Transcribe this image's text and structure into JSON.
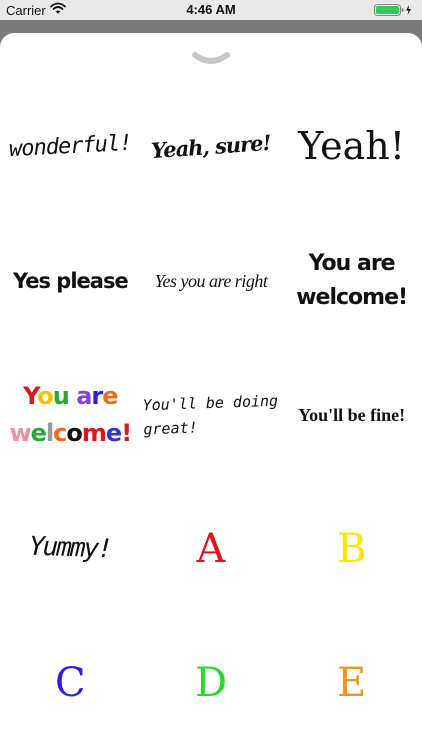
{
  "status_bar": {
    "carrier": "Carrier",
    "time": "4:46 AM"
  },
  "sheet": {
    "handle_icon": "chevron-down-icon"
  },
  "stickers": {
    "wonderful": "wonderful!",
    "yeah_sure": "Yeah, sure!",
    "yeah": "Yeah!",
    "yes_please": "Yes please",
    "yes_you_are_right": "Yes you are right",
    "welcome_black_line1": "You are",
    "welcome_black_line2": "welcome!",
    "welcome_color_line1": [
      "Y",
      "o",
      "u",
      " ",
      "a",
      "r",
      "e"
    ],
    "welcome_color_line2": [
      "w",
      "e",
      "l",
      "c",
      "o",
      "m",
      "e",
      "!"
    ],
    "doing_great_line1": "You'll be doing",
    "doing_great_line2": "great!",
    "be_fine": "You'll be fine!",
    "yummy": "Yummy!",
    "letter_a": "A",
    "letter_b": "B",
    "letter_c": "C",
    "letter_d": "D",
    "letter_e": "E"
  },
  "colors": {
    "status_bar_bg": "#e9e9e9",
    "backdrop": "#7a7a7a",
    "battery": "#34c759",
    "letter_a": "#e0141b",
    "letter_b": "#ffe600",
    "letter_c": "#2a1ee0",
    "letter_d": "#22dd22",
    "letter_e": "#f0941c",
    "welcome_line1": [
      "#e0141b",
      "#f5c400",
      "#22aa33",
      "#000000",
      "#8a3fd0",
      "#2a1ee0",
      "#f06a1c"
    ],
    "welcome_line2": [
      "#f08fa0",
      "#22aa33",
      "#999999",
      "#f06a1c",
      "#111111",
      "#e0141b",
      "#3a2fd0",
      "#e0141b"
    ]
  }
}
